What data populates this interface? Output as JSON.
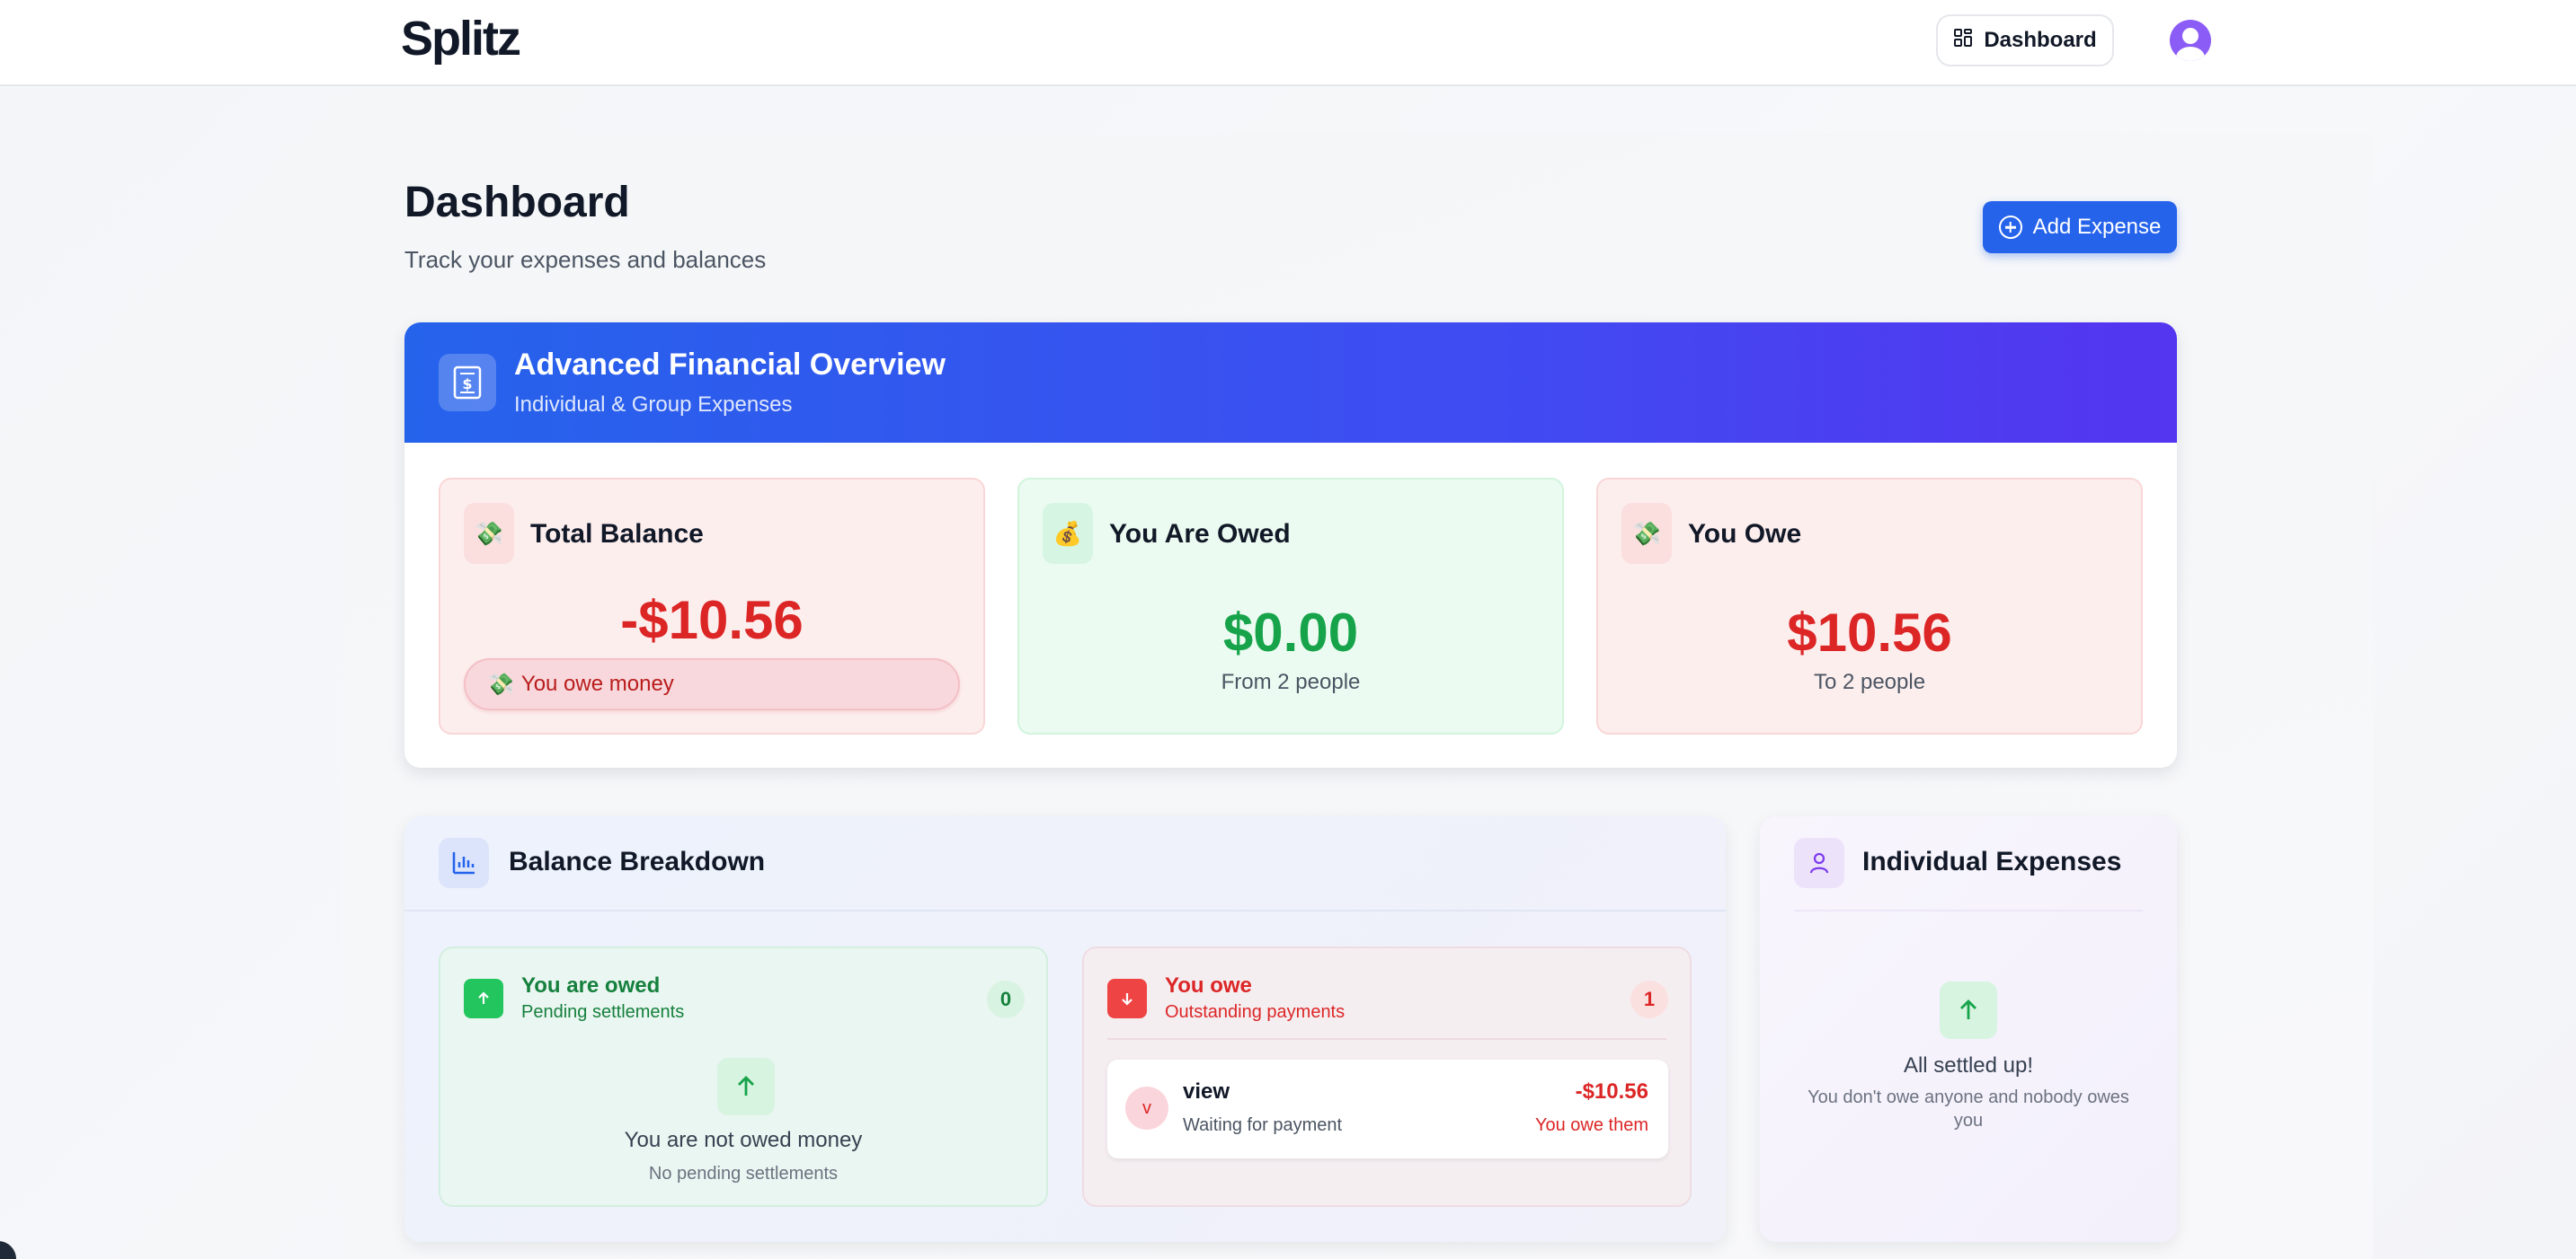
{
  "app": {
    "logo": "Splitz",
    "nav_dashboard_label": "Dashboard"
  },
  "header": {
    "title": "Dashboard",
    "subtitle": "Track your expenses and balances",
    "add_expense_label": "Add Expense"
  },
  "overview": {
    "title": "Advanced Financial Overview",
    "subtitle": "Individual & Group Expenses",
    "total_balance": {
      "emoji": "💸",
      "label": "Total Balance",
      "amount": "-$10.56",
      "pill_emoji": "💸",
      "pill_text": "You owe money"
    },
    "you_are_owed": {
      "emoji": "💰",
      "label": "You Are Owed",
      "amount": "$0.00",
      "note": "From 2 people"
    },
    "you_owe": {
      "emoji": "💸",
      "label": "You Owe",
      "amount": "$10.56",
      "note": "To 2 people"
    }
  },
  "breakdown": {
    "title": "Balance Breakdown",
    "owed": {
      "title": "You are owed",
      "desc": "Pending settlements",
      "count": "0",
      "empty_title": "You are not owed money",
      "empty_sub": "No pending settlements"
    },
    "owe": {
      "title": "You owe",
      "desc": "Outstanding payments",
      "count": "1",
      "rows": [
        {
          "avatar_letter": "v",
          "name": "view",
          "status": "Waiting for payment",
          "amount": "-$10.56",
          "note": "You owe them"
        }
      ]
    }
  },
  "individual": {
    "title": "Individual Expenses",
    "settled_title": "All settled up!",
    "settled_sub": "You don't owe anyone and nobody owes you"
  },
  "colors": {
    "primary": "#2563eb",
    "header_gradient_end": "#5435f0",
    "negative": "#dc2626",
    "positive": "#16a34a",
    "avatar": "#8b5cf6"
  },
  "icons": {
    "nav_dashboard": "grid-icon",
    "avatar": "user-avatar-icon",
    "add_expense": "plus-circle-icon",
    "overview": "dollar-receipt-icon",
    "breakdown": "bar-chart-icon",
    "owed_badge": "arrow-up-icon",
    "owe_badge": "arrow-down-icon",
    "individual": "user-icon"
  }
}
